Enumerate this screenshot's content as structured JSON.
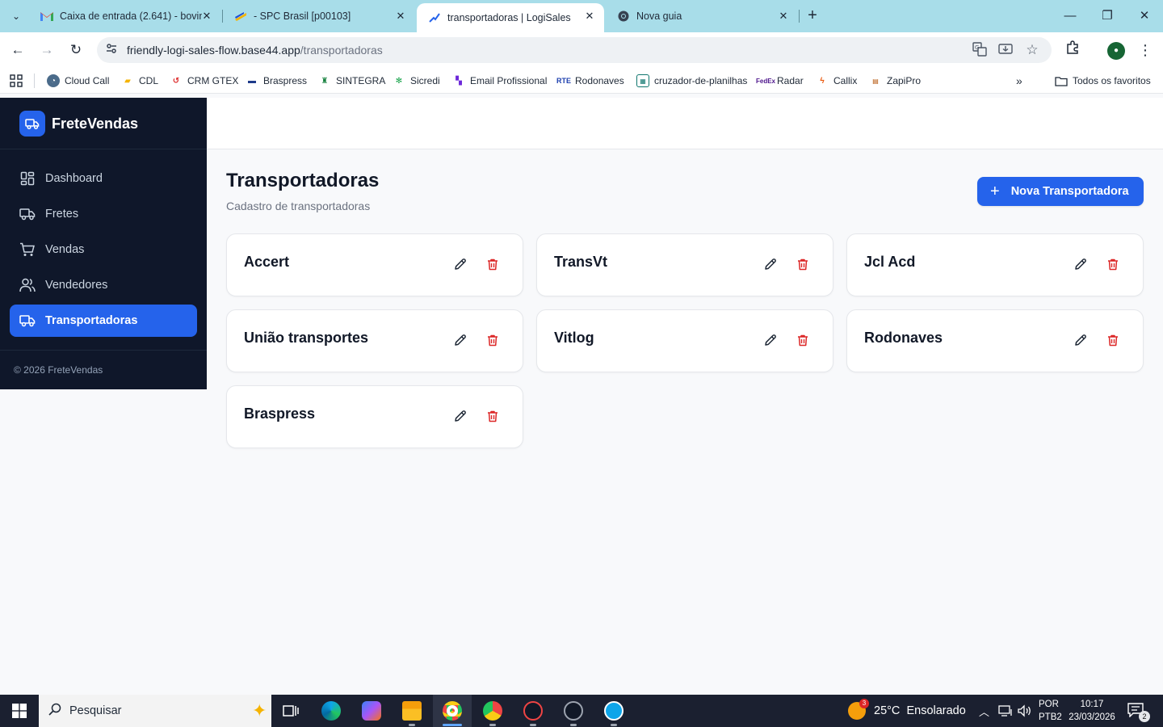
{
  "browser": {
    "tabs": [
      {
        "title": "Caixa de entrada (2.641) - bovin",
        "icon": "gmail-icon"
      },
      {
        "title": "- SPC Brasil [p00103]",
        "icon": "spc-icon"
      },
      {
        "title": "transportadoras | LogiSales",
        "icon": "logisales-icon"
      },
      {
        "title": "Nova guia",
        "icon": "chrome-icon"
      }
    ],
    "url_host": "friendly-logi-sales-flow.base44.app",
    "url_path": "/transportadoras",
    "bookmarks": [
      "Cloud Call",
      "CDL",
      "CRM GTEX",
      "Braspress",
      "SINTEGRA",
      "Sicredi",
      "Email Profissional",
      "Rodonaves",
      "cruzador-de-planilhas",
      "Radar",
      "Callix",
      "ZapiPro"
    ],
    "all_bookmarks": "Todos os favoritos"
  },
  "sidebar": {
    "brand": "FreteVendas",
    "items": [
      {
        "label": "Dashboard"
      },
      {
        "label": "Fretes"
      },
      {
        "label": "Vendas"
      },
      {
        "label": "Vendedores"
      },
      {
        "label": "Transportadoras",
        "active": true
      }
    ],
    "footer": "© 2026 FreteVendas"
  },
  "main": {
    "title": "Transportadoras",
    "subtitle": "Cadastro de transportadoras",
    "new_button": "Nova Transportadora",
    "carriers": [
      "Accert",
      "TransVt",
      "Jcl Acd",
      "União transportes",
      "Vitlog",
      "Rodonaves",
      "Braspress"
    ]
  },
  "taskbar": {
    "search_placeholder": "Pesquisar",
    "weather": "25°C  Ensolarado",
    "weather_badge": "3",
    "lang_line1": "POR",
    "lang_line2": "PTB2",
    "time": "10:17",
    "date": "23/03/2026",
    "notifications": "2"
  },
  "colors": {
    "sidebar_bg": "#0f172a",
    "accent": "#2563eb",
    "danger": "#dc2626",
    "tabbar_bg": "#a8dde9"
  }
}
